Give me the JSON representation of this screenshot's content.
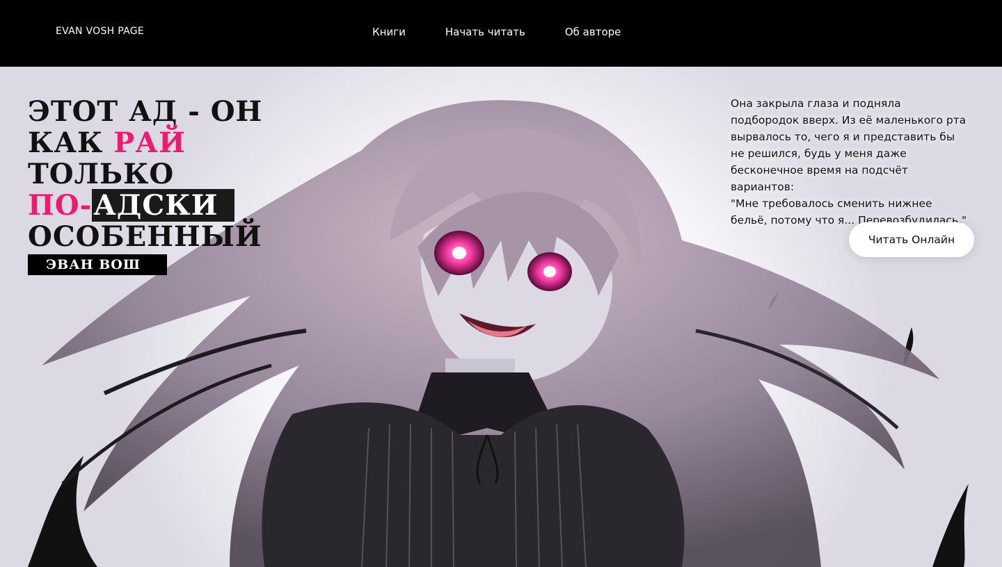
{
  "header": {
    "logo": "EVAN VOSH PAGE",
    "nav": [
      "Книги",
      "Начать читать",
      "Об авторе"
    ]
  },
  "hero": {
    "headline": {
      "line1": "Этот ад - он",
      "line2_a": "как ",
      "line2_b": "рай",
      "line3": "только",
      "line4_a": "по-",
      "line4_b": "адски",
      "line5": "особенный"
    },
    "author": "Эван Вош",
    "quote": {
      "p1": "Она закрыла глаза и подняла подбородок вверх. Из её маленького рта вырвалось то, чего я и представить бы не решился, будь у меня даже бесконечное время на подсчёт вариантов:",
      "p2": "\"Мне требовалось сменить нижнее бельё, потому что я... Перевозбудилась.\""
    },
    "cta": "Читать Онлайн",
    "illustration": "anime-girl-illustration"
  },
  "colors": {
    "topbar": "#000000",
    "accent": "#ee1a72",
    "background": "#f4f3f7"
  }
}
